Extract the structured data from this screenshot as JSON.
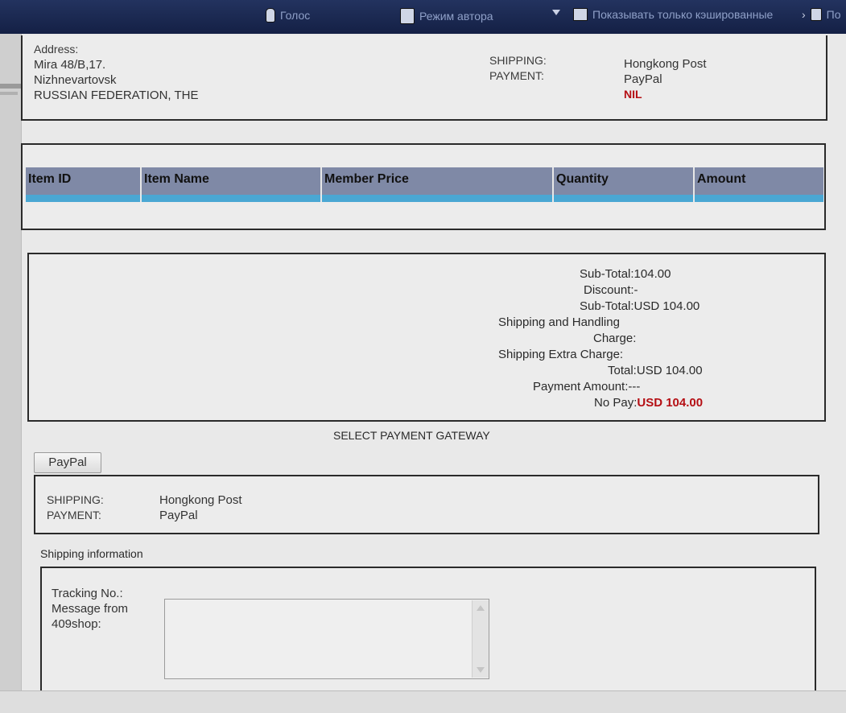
{
  "toolbar": {
    "voice_label": "Голос",
    "author_mode_label": "Режим автора",
    "cached_only_label": "Показывать только кэшированные",
    "cut_label": "По"
  },
  "order": {
    "address_label": "Address:",
    "address_line1": "Mira 48/B,17.",
    "city": "Nizhnevartovsk",
    "country": "RUSSIAN FEDERATION, THE",
    "shipping_label": "SHIPPING:",
    "shipping_value": "Hongkong Post",
    "payment_label": "PAYMENT:",
    "payment_value": "PayPal",
    "status": "NIL"
  },
  "items_table": {
    "columns": [
      "Item ID",
      "Item Name",
      "Member Price",
      "Quantity",
      "Amount"
    ]
  },
  "totals": {
    "subtotal_label": "Sub-Total:",
    "subtotal_value": "104.00",
    "discount_label": "Discount:",
    "discount_value": "-",
    "subtotal_usd_label": "Sub-Total:",
    "subtotal_usd_value": "USD 104.00",
    "shipping_handling_label_1": "Shipping and Handling",
    "shipping_handling_label_2": "Charge:",
    "shipping_extra_label": "Shipping Extra Charge:",
    "total_label": "Total:",
    "total_value": "USD 104.00",
    "payment_amount_label": "Payment Amount:",
    "payment_amount_value": "---",
    "no_pay_label": "No Pay:",
    "no_pay_value": "USD 104.00"
  },
  "gateway": {
    "heading": "SELECT PAYMENT GATEWAY",
    "paypal_button": "PayPal"
  },
  "summary": {
    "shipping_label": "SHIPPING:",
    "shipping_value": "Hongkong Post",
    "payment_label": "PAYMENT:",
    "payment_value": "PayPal"
  },
  "shipping_info": {
    "heading": "Shipping information",
    "tracking_label": "Tracking No.:",
    "message_label_1": "Message from",
    "message_label_2": "409shop:",
    "message_value": ""
  },
  "colors": {
    "accent_red": "#b50f14",
    "table_header": "#7f89a6",
    "table_stripe": "#4aa7d3",
    "toolbar_bg": "#1b2a52"
  }
}
